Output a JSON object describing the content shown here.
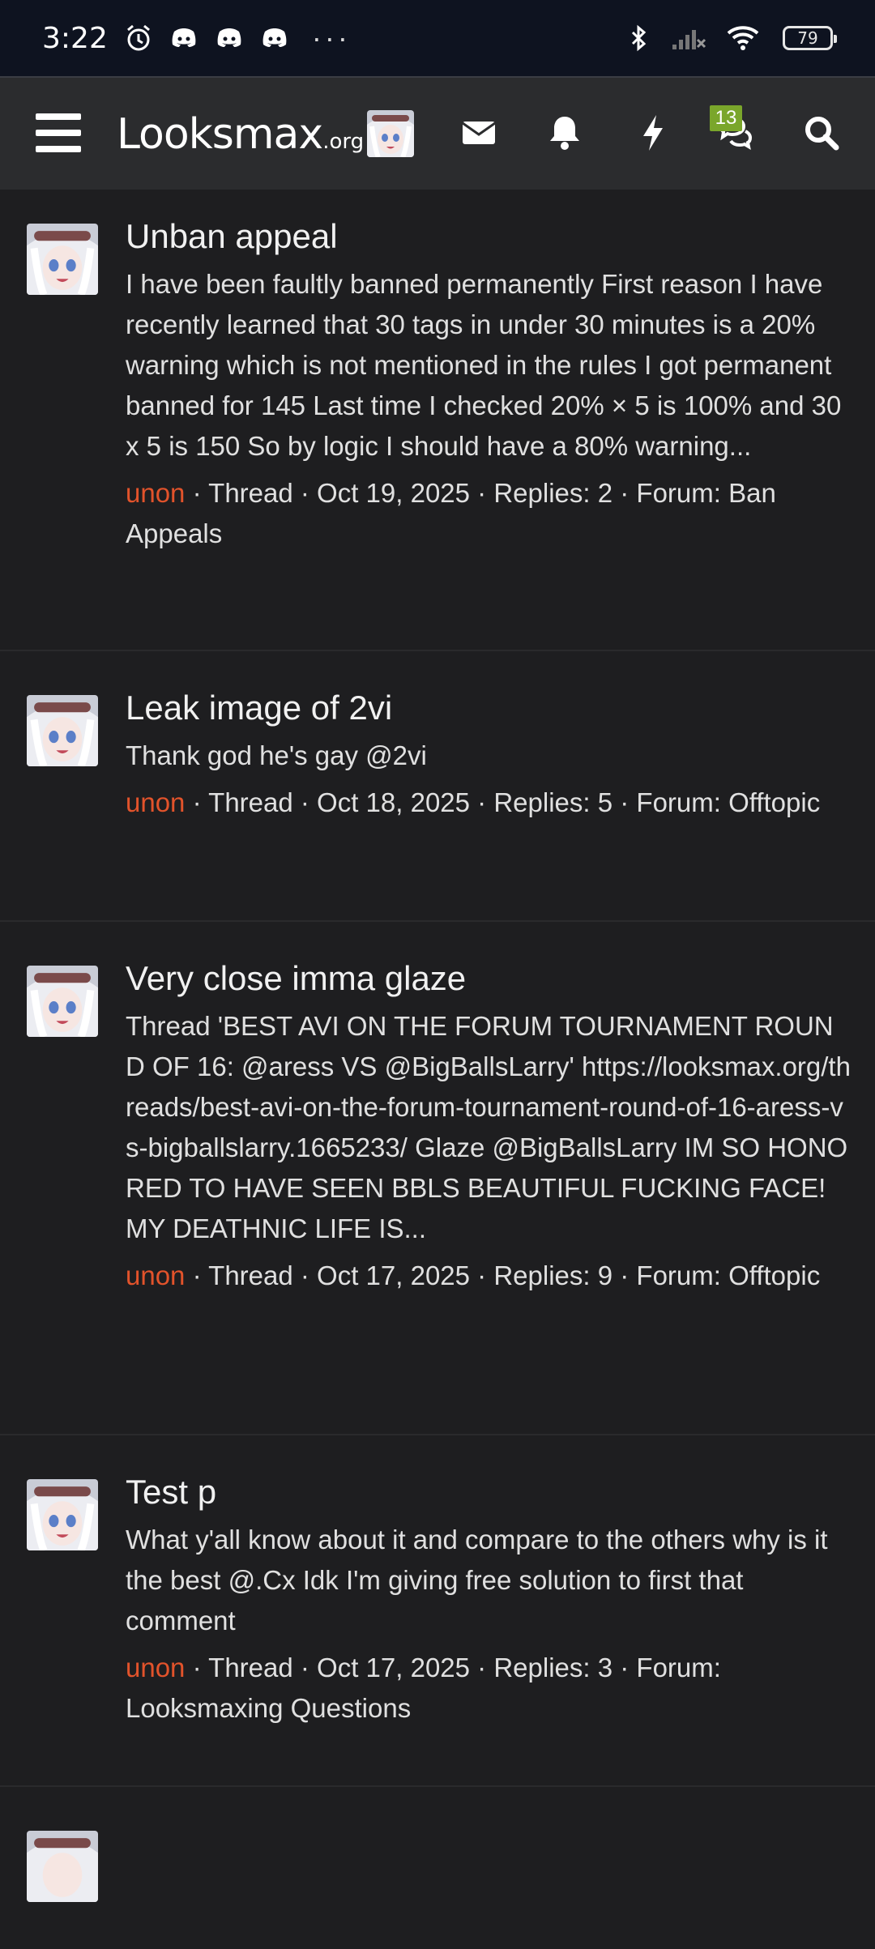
{
  "status_bar": {
    "time": "3:22",
    "left_icons": [
      "alarm-icon",
      "discord-icon",
      "discord-icon",
      "discord-icon"
    ],
    "overflow": "···",
    "right_icons": [
      "bluetooth-icon",
      "cell-signal-off-icon",
      "wifi-icon"
    ],
    "battery": "79"
  },
  "header": {
    "logo_main": "Looksmax",
    "logo_suffix": ".org",
    "notification_badge": "13",
    "icons": [
      "menu-icon",
      "inbox-icon",
      "bell-icon",
      "lightning-icon",
      "chat-icon",
      "search-icon"
    ]
  },
  "results": [
    {
      "title": "Unban appeal",
      "snippet": "I have been faultly banned permanently First reason I have recently learned that 30 tags in under 30 minutes is a 20% warning which is not mentioned in the rules I got permanent banned for 145 Last time I checked 20% × 5 is 100% and 30 x 5 is 150 So by logic I should have a 80% warning...",
      "user": "unon",
      "type": "Thread",
      "date": "Oct 19, 2025",
      "replies": "Replies: 2",
      "forum": "Forum: Ban Appeals"
    },
    {
      "title": "Leak image of 2vi",
      "snippet": "Thank god he's gay @2vi",
      "user": "unon",
      "type": "Thread",
      "date": "Oct 18, 2025",
      "replies": "Replies: 5",
      "forum": "Forum: Offtopic"
    },
    {
      "title": "Very close imma glaze",
      "snippet": "Thread 'BEST AVI ON THE FORUM TOURNAMENT ROUND OF 16: @aress VS @BigBallsLarry' https://looksmax.org/threads/best-avi-on-the-forum-tournament-round-of-16-aress-vs-bigballslarry.1665233/ Glaze @BigBallsLarry IM SO HONORED TO HAVE SEEN BBLS BEAUTIFUL FUCKING FACE! MY DEATHNIC LIFE IS...",
      "user": "unon",
      "type": "Thread",
      "date": "Oct 17, 2025",
      "replies": "Replies: 9",
      "forum": "Forum: Offtopic"
    },
    {
      "title": "Test p",
      "snippet": "What y'all know about it and compare to the others why is it the best @.Cx Idk I'm giving free solution to first that comment",
      "user": "unon",
      "type": "Thread",
      "date": "Oct 17, 2025",
      "replies": "Replies: 3",
      "forum": "Forum: Looksmaxing Questions"
    }
  ]
}
